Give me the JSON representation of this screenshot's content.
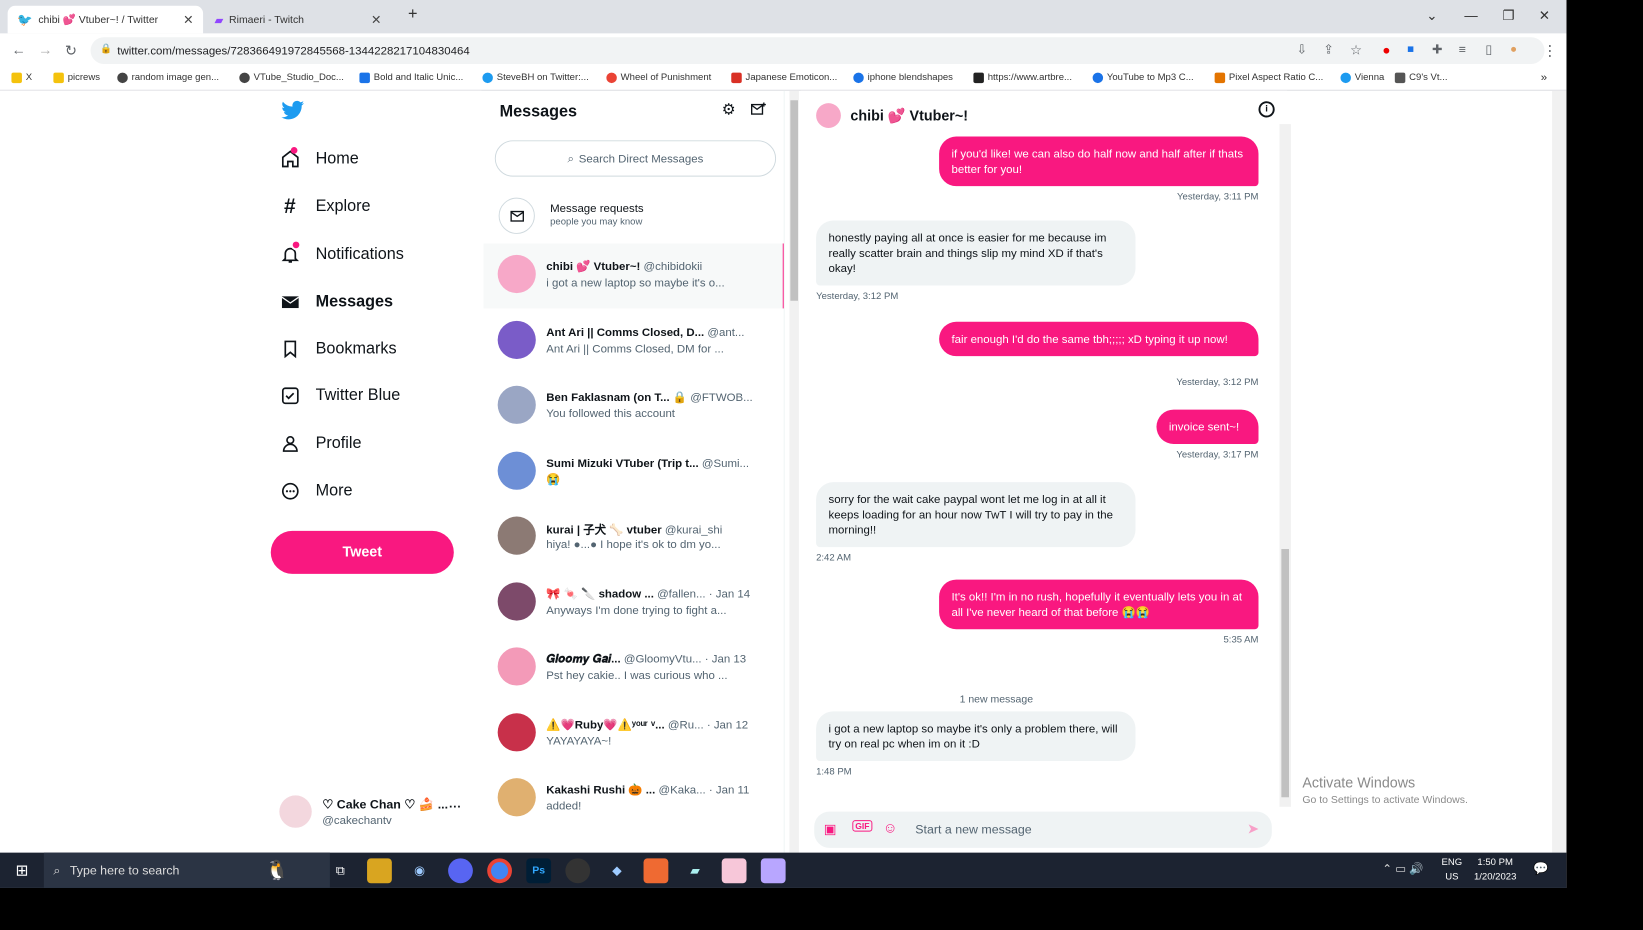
{
  "browser": {
    "tabs": [
      {
        "label": "chibi 💕 Vtuber~! / Twitter",
        "close": "✕"
      },
      {
        "label": "Rimaeri - Twitch",
        "close": "✕"
      }
    ],
    "new_tab": "+",
    "url": "twitter.com/messages/728366491972845568-1344228217104830464",
    "bookmarks": [
      {
        "label": "X",
        "color": "#f4c20d"
      },
      {
        "label": "picrews",
        "color": "#f4c20d"
      },
      {
        "label": "random image gen...",
        "color": "#444"
      },
      {
        "label": "VTube_Studio_Doc...",
        "color": "#444"
      },
      {
        "label": "Bold and Italic Unic...",
        "color": "#1a73e8"
      },
      {
        "label": "SteveBH on Twitter:...",
        "color": "#1d9bf0"
      },
      {
        "label": "Wheel of Punishment",
        "color": "#ea4335"
      },
      {
        "label": "Japanese Emoticon...",
        "color": "#d93025"
      },
      {
        "label": "iphone blendshapes",
        "color": "#1a73e8"
      },
      {
        "label": "https://www.artbre...",
        "color": "#222"
      },
      {
        "label": "YouTube to Mp3 C...",
        "color": "#1a73e8"
      },
      {
        "label": "Pixel Aspect Ratio C...",
        "color": "#e37400"
      },
      {
        "label": "Vienna",
        "color": "#1d9bf0"
      },
      {
        "label": "C9's Vt...",
        "color": "#555"
      }
    ],
    "bookmarks_more": "»"
  },
  "nav": {
    "items": [
      {
        "label": "Home",
        "icon": "home-icon"
      },
      {
        "label": "Explore",
        "icon": "hashtag-icon"
      },
      {
        "label": "Notifications",
        "icon": "bell-icon"
      },
      {
        "label": "Messages",
        "icon": "envelope-icon"
      },
      {
        "label": "Bookmarks",
        "icon": "bookmark-icon"
      },
      {
        "label": "Twitter Blue",
        "icon": "twitter-blue-icon"
      },
      {
        "label": "Profile",
        "icon": "person-icon"
      },
      {
        "label": "More",
        "icon": "more-circle-icon"
      }
    ],
    "tweet_label": "Tweet",
    "account": {
      "name": "♡ Cake Chan ♡ 🍰 ...",
      "handle": "@cakechantv",
      "more": "···"
    }
  },
  "messages_panel": {
    "title": "Messages",
    "search_placeholder": "Search Direct Messages",
    "requests": {
      "title": "Message requests",
      "subtitle": "people you may know"
    },
    "conversations": [
      {
        "name": "chibi 💕 Vtuber~!",
        "handle": "@chibidokii",
        "date": "",
        "preview": "i got a new laptop so maybe it's o...",
        "color": "#f7a8c8",
        "selected": true
      },
      {
        "name": "Ant Ari || Comms Closed, D...",
        "handle": "@ant...",
        "date": "",
        "preview": "Ant Ari || Comms Closed, DM for ...",
        "color": "#7a5cc8",
        "selected": false
      },
      {
        "name": "Ben Faklasnam (on T... 🔒",
        "handle": "@FTWOB...",
        "date": "",
        "preview": "You followed this account",
        "color": "#9aa6c4",
        "selected": false
      },
      {
        "name": "Sumi Mizuki VTuber (Trip t...",
        "handle": "@Sumi...",
        "date": "",
        "preview": "😭",
        "color": "#6d8fd6",
        "selected": false
      },
      {
        "name": "kurai | 子犬 🦴 vtuber",
        "handle": "@kurai_shi",
        "date": "",
        "preview": "hiya! ●...● I hope it's ok to dm yo...",
        "color": "#8c7a74",
        "selected": false
      },
      {
        "name": "🎀 🍬 🔪 shadow ...",
        "handle": "@fallen...",
        "date": "· Jan 14",
        "preview": "Anyways I'm done trying to fight a...",
        "color": "#7d4a6a",
        "selected": false
      },
      {
        "name": "𝑮𝒍𝒐𝒐𝒎𝒚 𝑮𝒂𝒊...",
        "handle": "@GloomyVtu...",
        "date": "· Jan 13",
        "preview": "Pst hey cakie.. I was curious who ...",
        "color": "#f39ab8",
        "selected": false
      },
      {
        "name": "⚠️💗Ruby💗⚠️ʸᵒᵘʳ ᵛ...",
        "handle": "@Ru...",
        "date": "· Jan 12",
        "preview": "YAYAYAYA~!",
        "color": "#c8304a",
        "selected": false
      },
      {
        "name": "Kakashi Rushi 🎃 ...",
        "handle": "@Kaka...",
        "date": "· Jan 11",
        "preview": "added!",
        "color": "#e0b070",
        "selected": false
      }
    ]
  },
  "chat": {
    "title": "chibi 💕 Vtuber~!",
    "messages": [
      {
        "from": "me",
        "text": "if you'd like! we can also do half now and half after if thats better for you!",
        "time": "Yesterday, 3:11 PM"
      },
      {
        "from": "them",
        "text": "honestly paying all at once is easier for me because im really scatter brain and things slip my mind XD if that's okay!",
        "time": "Yesterday, 3:12 PM"
      },
      {
        "from": "me",
        "text": "fair enough I'd do the same tbh;;;;; xD typing it up now!",
        "time": "Yesterday, 3:12 PM"
      },
      {
        "from": "me",
        "text": "invoice sent~!",
        "time": "Yesterday, 3:17 PM"
      },
      {
        "from": "them",
        "text": "sorry for the wait cake paypal wont let me log in at all it keeps loading for an hour now TwT I will try to pay in the morning!!",
        "time": "2:42 AM"
      },
      {
        "from": "me",
        "text": "It's ok!! I'm in no rush, hopefully it eventually lets you in at all I've never heard of that before 😭😭",
        "time": "5:35 AM"
      },
      {
        "from": "them",
        "text": "i got a new laptop so maybe it's only a problem there, will try on real pc when im on it :D",
        "time": "1:48 PM"
      }
    ],
    "new_message_divider": "1 new message",
    "composer_placeholder": "Start a new message"
  },
  "watermark": {
    "title": "Activate Windows",
    "subtitle": "Go to Settings to activate Windows."
  },
  "taskbar": {
    "search_placeholder": "Type here to search",
    "lang": "ENG",
    "region": "US",
    "time": "1:50 PM",
    "date": "1/20/2023"
  },
  "colors": {
    "accent": "#f91880",
    "twitter_blue": "#1d9bf0"
  }
}
